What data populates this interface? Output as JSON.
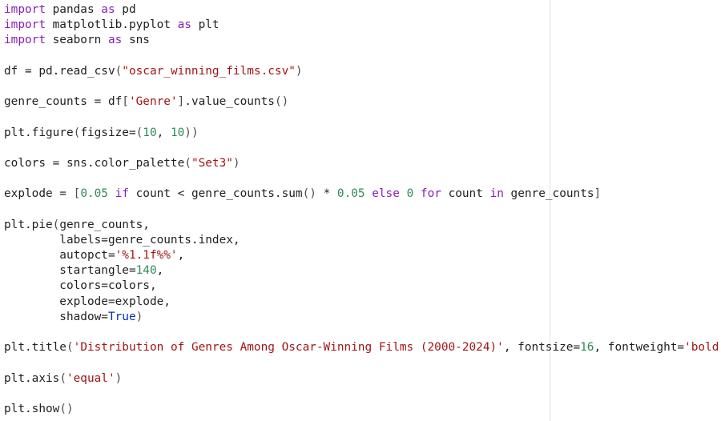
{
  "code": {
    "lines": [
      [
        {
          "t": "import",
          "c": "kw"
        },
        {
          "t": " pandas "
        },
        {
          "t": "as",
          "c": "kw"
        },
        {
          "t": " pd"
        }
      ],
      [
        {
          "t": "import",
          "c": "kw"
        },
        {
          "t": " matplotlib.pyplot "
        },
        {
          "t": "as",
          "c": "kw"
        },
        {
          "t": " plt"
        }
      ],
      [
        {
          "t": "import",
          "c": "kw"
        },
        {
          "t": " seaborn "
        },
        {
          "t": "as",
          "c": "kw"
        },
        {
          "t": " sns"
        }
      ],
      [],
      [
        {
          "t": "df = pd.read_csv"
        },
        {
          "t": "(",
          "c": "br"
        },
        {
          "t": "\"oscar_winning_films.csv\"",
          "c": "str"
        },
        {
          "t": ")",
          "c": "br"
        }
      ],
      [],
      [
        {
          "t": "genre_counts = df"
        },
        {
          "t": "[",
          "c": "br"
        },
        {
          "t": "'Genre'",
          "c": "str"
        },
        {
          "t": "]",
          "c": "br"
        },
        {
          "t": ".value_counts"
        },
        {
          "t": "()",
          "c": "br"
        }
      ],
      [],
      [
        {
          "t": "plt.figure"
        },
        {
          "t": "(",
          "c": "br"
        },
        {
          "t": "figsize="
        },
        {
          "t": "(",
          "c": "br"
        },
        {
          "t": "10",
          "c": "num"
        },
        {
          "t": ", "
        },
        {
          "t": "10",
          "c": "num"
        },
        {
          "t": "))",
          "c": "br"
        }
      ],
      [],
      [
        {
          "t": "colors = sns.color_palette"
        },
        {
          "t": "(",
          "c": "br"
        },
        {
          "t": "\"Set3\"",
          "c": "str"
        },
        {
          "t": ")",
          "c": "br"
        }
      ],
      [],
      [
        {
          "t": "explode = "
        },
        {
          "t": "[",
          "c": "br"
        },
        {
          "t": "0.05",
          "c": "num"
        },
        {
          "t": " "
        },
        {
          "t": "if",
          "c": "kw"
        },
        {
          "t": " count < genre_counts.sum"
        },
        {
          "t": "()",
          "c": "br"
        },
        {
          "t": " * "
        },
        {
          "t": "0.05",
          "c": "num"
        },
        {
          "t": " "
        },
        {
          "t": "else",
          "c": "kw"
        },
        {
          "t": " "
        },
        {
          "t": "0",
          "c": "num"
        },
        {
          "t": " "
        },
        {
          "t": "for",
          "c": "kw"
        },
        {
          "t": " count "
        },
        {
          "t": "in",
          "c": "kw"
        },
        {
          "t": " genre_counts"
        },
        {
          "t": "]",
          "c": "br"
        }
      ],
      [],
      [
        {
          "t": "plt.pie"
        },
        {
          "t": "(",
          "c": "br"
        },
        {
          "t": "genre_counts,"
        }
      ],
      [
        {
          "t": "        labels=genre_counts.index,"
        }
      ],
      [
        {
          "t": "        autopct="
        },
        {
          "t": "'%1.1f%%'",
          "c": "str"
        },
        {
          "t": ","
        }
      ],
      [
        {
          "t": "        startangle="
        },
        {
          "t": "140",
          "c": "num"
        },
        {
          "t": ","
        }
      ],
      [
        {
          "t": "        colors=colors,"
        }
      ],
      [
        {
          "t": "        explode=explode,"
        }
      ],
      [
        {
          "t": "        shadow="
        },
        {
          "t": "True",
          "c": "bool"
        },
        {
          "t": ")",
          "c": "br"
        }
      ],
      [],
      [
        {
          "t": "plt.title"
        },
        {
          "t": "(",
          "c": "br"
        },
        {
          "t": "'Distribution of Genres Among Oscar-Winning Films (2000-2024)'",
          "c": "str"
        },
        {
          "t": ", fontsize="
        },
        {
          "t": "16",
          "c": "num"
        },
        {
          "t": ", fontweight="
        },
        {
          "t": "'bold'",
          "c": "str"
        },
        {
          "t": ")",
          "c": "br"
        }
      ],
      [],
      [
        {
          "t": "plt.axis"
        },
        {
          "t": "(",
          "c": "br"
        },
        {
          "t": "'equal'",
          "c": "str"
        },
        {
          "t": ")",
          "c": "br"
        }
      ],
      [],
      [
        {
          "t": "plt.show"
        },
        {
          "t": "()",
          "c": "br"
        }
      ]
    ]
  }
}
